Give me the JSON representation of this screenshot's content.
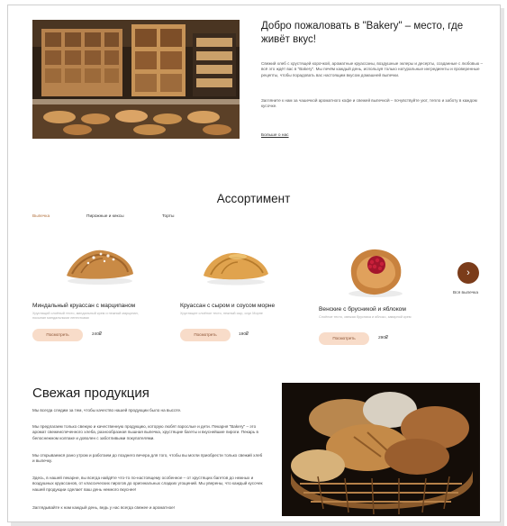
{
  "hero": {
    "title": "Добро пожаловать в \"Bakery\" – место, где живёт вкус!",
    "paragraph1": "Свежий хлеб с хрустящей корочкой, ароматные круассаны, воздушные эклеры и десерты, созданные с любовью – всё это ждёт вас в \"Bakery\". Мы печём каждый день, используя только натуральные ингредиенты и проверенные рецепты, чтобы порадовать вас настоящим вкусом домашней выпечки.",
    "paragraph2": "Загляните к нам за чашечкой ароматного кофе и свежей выпечкой – почувствуйте уют, тепло и заботу в каждом кусочке.",
    "more_link": "Больше о нас"
  },
  "assortment": {
    "title": "Ассортимент",
    "tabs": [
      {
        "label": "Выпечка",
        "active": true
      },
      {
        "label": "Пирожные и кексы",
        "active": false
      },
      {
        "label": "Торты",
        "active": false
      }
    ],
    "products": [
      {
        "name": "Миндальный круассан с марципаном",
        "desc": "Хрустящий слоёный тесто, миндальный крем и нежный марципан, посыпан миндальными лепестками",
        "button": "Посмотреть",
        "price": "240₽"
      },
      {
        "name": "Круассан с сыром и соусом морне",
        "desc": "Хрустящее слоёное тесто, нежный сыр, соус Морне",
        "button": "Посмотреть",
        "price": "190₽"
      },
      {
        "name": "Венские с брусникой и яблоком",
        "desc": "Слоёное тесто, свежая брусника и яблоко, заварной крем",
        "button": "Посмотреть",
        "price": "290₽"
      }
    ],
    "see_all": "Вся выпечка"
  },
  "fresh": {
    "title": "Свежая продукция",
    "p1": "Мы всегда следим за тем, чтобы качество нашей продукции было на высоте.",
    "p2": "Мы предлагаем только свежую и качественную продукцию, которую любят взрослые и дети. Пекарня \"Bakery\" – это аромат свежеиспеченного хлеба, разнообразная пышная выпечка, хрустящие багеты и вкуснейшие пироги. Пекарь в белоснежном колпаке и доволен с заботливыми покупателями.",
    "p3": "Мы открываемся рано утром и работаем до позднего вечера для того, чтобы вы могли приобрести только свежий хлеб и выпечку.",
    "p4": "Здесь, в нашей пекарне, вы всегда найдёте что-то по-настоящему особенное – от хрустящих багетов до нежных и воздушных круассанов, от классических пирогов до оригинальных сладких угощений. Мы уверены, что каждый кусочек нашей продукции сделает ваш день немного вкуснее!",
    "p5": "Заглядывайте к нам каждый день, ведь у нас всегда свежее и ароматное!"
  },
  "colors": {
    "accent": "#b2703c",
    "button_bg": "#f8dcc9",
    "arrow_bg": "#7b3c1a"
  }
}
